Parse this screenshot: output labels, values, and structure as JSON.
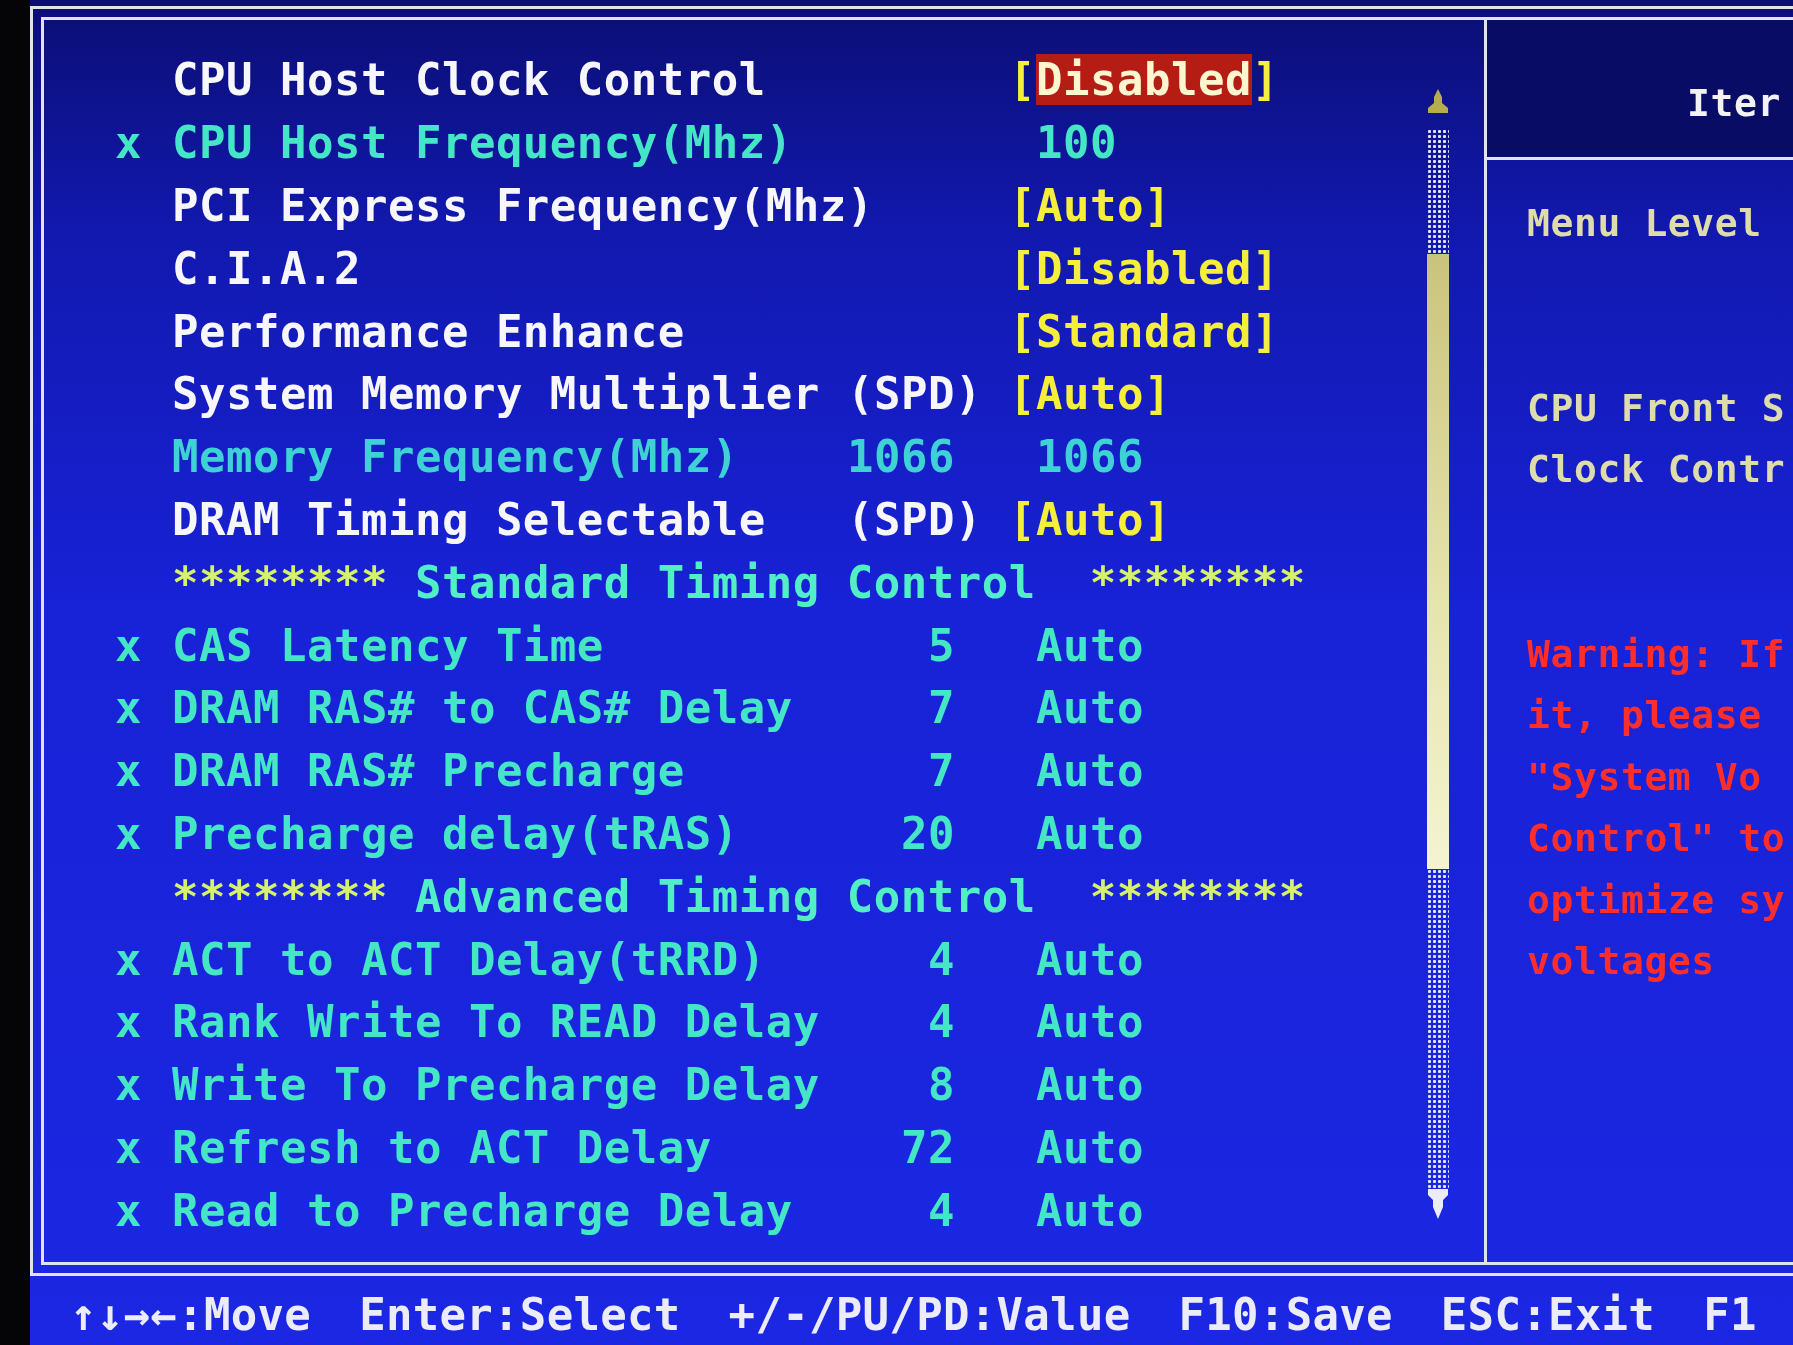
{
  "settings": {
    "items": [
      {
        "kind": "setting",
        "disabled": false,
        "selected": true,
        "label": "CPU Host Clock Control",
        "value": "[Disabled]"
      },
      {
        "kind": "setting",
        "disabled": true,
        "selected": false,
        "prefix": "x",
        "label": "CPU Host Frequency(Mhz)",
        "value": "100"
      },
      {
        "kind": "setting",
        "disabled": false,
        "selected": false,
        "label": "PCI Express Frequency(Mhz)",
        "value": "[Auto]"
      },
      {
        "kind": "setting",
        "disabled": false,
        "selected": false,
        "label": "C.I.A.2",
        "value": "[Disabled]"
      },
      {
        "kind": "setting",
        "disabled": false,
        "selected": false,
        "label": "Performance Enhance",
        "value": "[Standard]"
      },
      {
        "kind": "setting",
        "disabled": false,
        "selected": false,
        "label": "System Memory Multiplier",
        "column_2": "(SPD)",
        "value": "[Auto]"
      },
      {
        "kind": "info",
        "disabled": false,
        "selected": false,
        "label": "Memory Frequency(Mhz)",
        "column_2": "1066",
        "value": "1066"
      },
      {
        "kind": "setting",
        "disabled": false,
        "selected": false,
        "label": "DRAM Timing Selectable",
        "column_2": "(SPD)",
        "value": "[Auto]"
      }
    ],
    "sections": [
      {
        "stars_left": "********",
        "title": "Standard Timing Control",
        "stars_right": "********",
        "items": [
          {
            "kind": "setting",
            "disabled": true,
            "selected": false,
            "prefix": "x",
            "label": "CAS Latency Time",
            "column_2": "5",
            "value": "Auto"
          },
          {
            "kind": "setting",
            "disabled": true,
            "selected": false,
            "prefix": "x",
            "label": "DRAM RAS# to CAS# Delay",
            "column_2": "7",
            "value": "Auto"
          },
          {
            "kind": "setting",
            "disabled": true,
            "selected": false,
            "prefix": "x",
            "label": "DRAM RAS# Precharge",
            "column_2": "7",
            "value": "Auto"
          },
          {
            "kind": "setting",
            "disabled": true,
            "selected": false,
            "prefix": "x",
            "label": "Precharge delay(tRAS)",
            "column_2": "20",
            "value": "Auto"
          }
        ]
      },
      {
        "stars_left": "********",
        "title": "Advanced Timing Control",
        "stars_right": "********",
        "items": [
          {
            "kind": "setting",
            "disabled": true,
            "selected": false,
            "prefix": "x",
            "label": "ACT to ACT Delay(tRRD)",
            "column_2": "4",
            "value": "Auto"
          },
          {
            "kind": "setting",
            "disabled": true,
            "selected": false,
            "prefix": "x",
            "label": "Rank Write To READ Delay",
            "column_2": "4",
            "value": "Auto"
          },
          {
            "kind": "setting",
            "disabled": true,
            "selected": false,
            "prefix": "x",
            "label": "Write To Precharge Delay",
            "column_2": "8",
            "value": "Auto"
          },
          {
            "kind": "setting",
            "disabled": true,
            "selected": false,
            "prefix": "x",
            "label": "Refresh to ACT Delay",
            "column_2": "72",
            "value": "Auto"
          },
          {
            "kind": "setting",
            "disabled": true,
            "selected": false,
            "prefix": "x",
            "label": "Read to Precharge Delay",
            "column_2": "4",
            "value": "Auto"
          }
        ]
      }
    ]
  },
  "help": {
    "title": "Iter",
    "menu_level": "Menu Level",
    "description": [
      "CPU Front S",
      "Clock Contr"
    ],
    "warning": [
      "Warning: If",
      "it, please",
      "\"System Vo",
      "Control\" to",
      "optimize sy",
      "voltages"
    ]
  },
  "key_bar": [
    "↑↓→←:Move",
    "Enter:Select",
    "+/-/PU/PD:Value",
    "F10:Save",
    "ESC:Exit",
    "F1"
  ]
}
